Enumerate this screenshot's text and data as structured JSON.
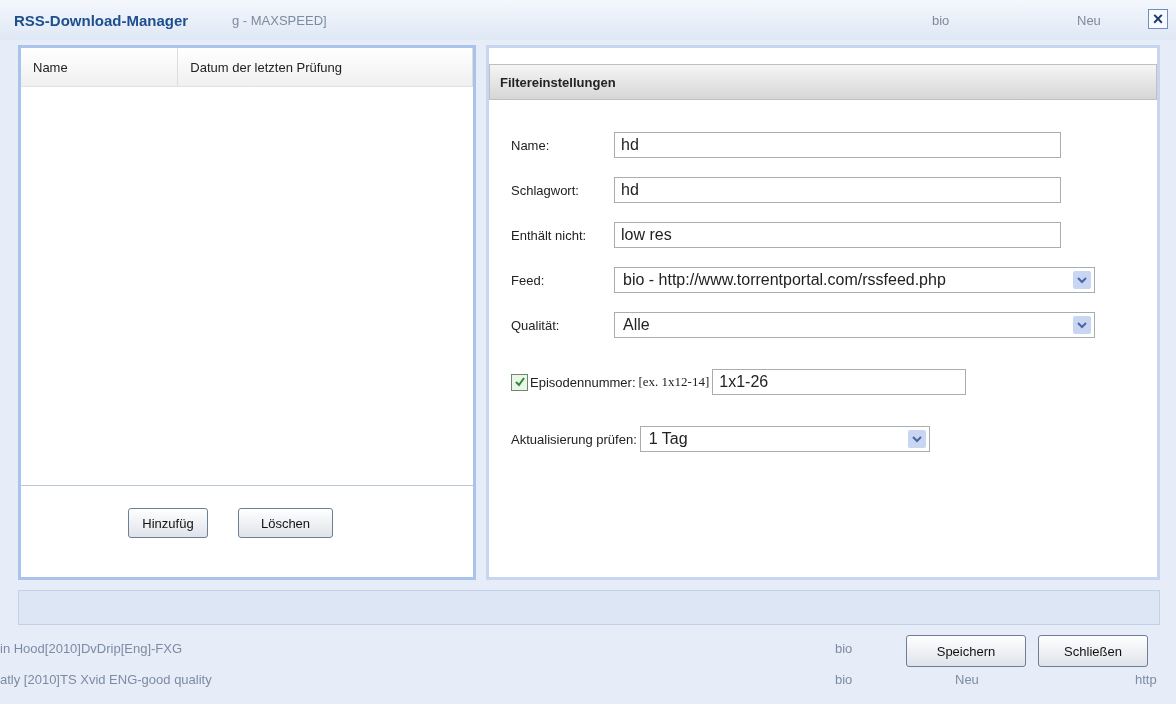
{
  "window": {
    "title": "RSS-Download-Manager",
    "close": "×"
  },
  "background_rows": [
    {
      "cells": [
        "g - MAXSPEED]",
        "bio",
        "Neu"
      ]
    },
    {
      "cells": [
        "in Hood[2010]DvDrip[Eng]-FXG",
        "bio"
      ]
    },
    {
      "cells": [
        "atly [2010]TS Xvid ENG-good quality",
        "bio",
        "Neu",
        "http"
      ]
    }
  ],
  "feed_list": {
    "columns": [
      "Name",
      "Datum der letzten Prüfung"
    ],
    "buttons": [
      "Hinzufüg",
      "Löschen"
    ]
  },
  "filter": {
    "title": "Filtereinstellungen",
    "fields": [
      {
        "kind": "text",
        "label": "Name:",
        "value": "hd"
      },
      {
        "kind": "text",
        "label": "Schlagwort:",
        "value": "hd"
      },
      {
        "kind": "text",
        "label": "Enthält nicht:",
        "value": "low res"
      },
      {
        "kind": "select",
        "label": "Feed:",
        "value": "bio - http://www.torrentportal.com/rssfeed.php"
      },
      {
        "kind": "select",
        "label": "Qualität:",
        "value": "Alle"
      }
    ],
    "episode": {
      "checked": true,
      "label": "Episodennummer:",
      "hint": "[ex. 1x12-14]",
      "value": "1x1-26"
    },
    "update": {
      "label": "Aktualisierung prüfen:",
      "value": "1 Tag"
    }
  },
  "buttons": [
    "Speichern",
    "Schließen"
  ]
}
